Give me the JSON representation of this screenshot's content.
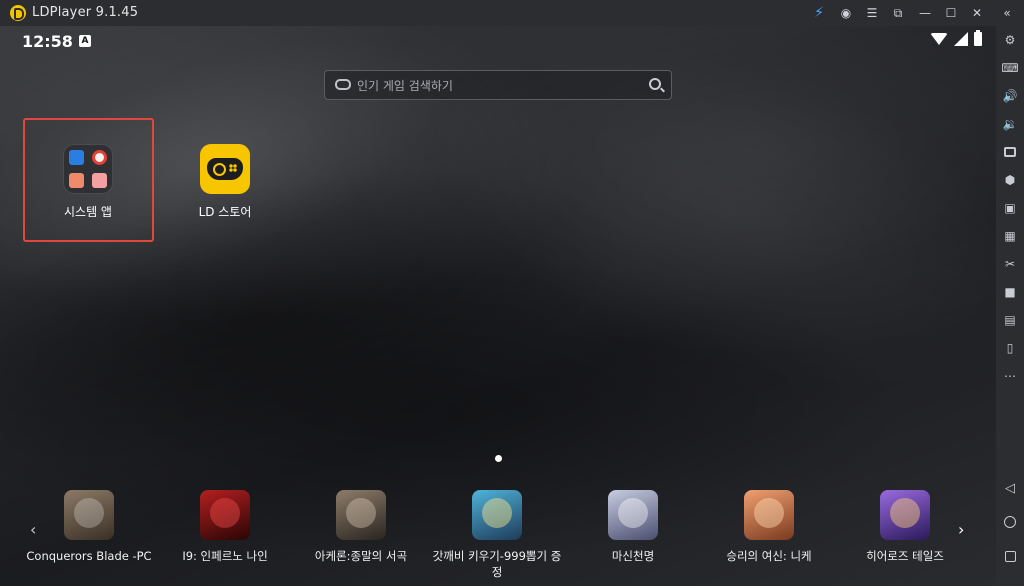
{
  "titlebar": {
    "app_name": "LDPlayer 9.1.45",
    "icons": [
      "bolt-icon",
      "account-icon",
      "menu-icon",
      "restore-icon",
      "minimize-icon",
      "maximize-icon",
      "close-icon",
      "collapse-icon"
    ]
  },
  "status_bar": {
    "time": "12:58",
    "notification_glyph": "A",
    "icons": [
      "wifi-icon",
      "signal-icon",
      "battery-icon"
    ]
  },
  "search": {
    "placeholder": "인기 게임 검색하기",
    "value": ""
  },
  "home_apps": [
    {
      "label": "시스템 앱",
      "type": "folder"
    },
    {
      "label": "LD 스토어",
      "type": "app"
    }
  ],
  "dock": {
    "games": [
      {
        "label": "Conquerors Blade -PC",
        "color": "#6b5a4a"
      },
      {
        "label": "I9: 인페르노 나인",
        "color": "#8e1a1a"
      },
      {
        "label": "아케론:종말의 서곡",
        "color": "#5a5046"
      },
      {
        "label": "갓깨비 키우기-999뽑기 증정",
        "color": "#2f6f8a"
      },
      {
        "label": "마신천명",
        "color": "#8a8fb0"
      },
      {
        "label": "승리의 여신: 니케",
        "color": "#c0704a"
      },
      {
        "label": "히어로즈 테일즈",
        "color": "#6a4aa0"
      }
    ]
  },
  "right_toolbar": {
    "icons": [
      "settings-icon",
      "keyboard-icon",
      "volume-up-icon",
      "volume-down-icon",
      "screenshot-icon",
      "install-apk-icon",
      "shared-folder-icon",
      "macro-icon",
      "cut-icon",
      "record-icon",
      "sync-icon",
      "rotate-icon",
      "more-icon",
      "back-icon",
      "home-icon",
      "recents-icon"
    ]
  },
  "colors": {
    "accent_yellow": "#f7c600",
    "highlight_red": "#e0483c",
    "chrome": "#2b2d31"
  }
}
